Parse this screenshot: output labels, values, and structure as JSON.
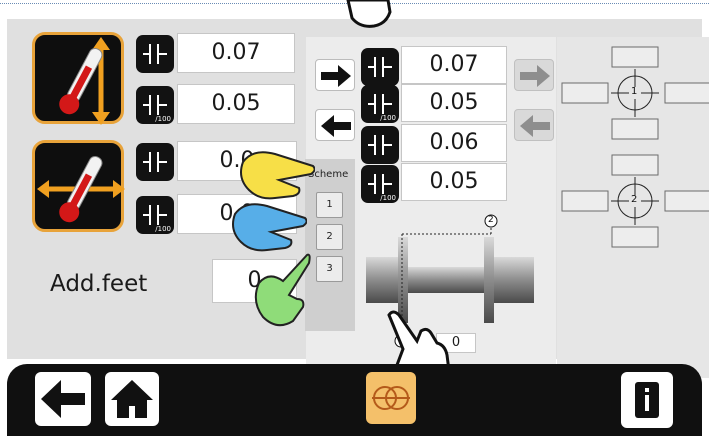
{
  "temperature_compensation": {
    "vertical": {
      "value_1": "0.07",
      "value_2": "0.05",
      "unit_label_2": "/100"
    },
    "horizontal": {
      "value_1": "0.0",
      "value_2": "0.0",
      "unit_label_2": "/100"
    }
  },
  "add_feet": {
    "label": "Add.feet",
    "value": "0"
  },
  "scheme": {
    "title": "Scheme",
    "options": [
      "1",
      "2",
      "3"
    ]
  },
  "target_values": {
    "values": [
      "0.07",
      "0.05",
      "0.06",
      "0.05"
    ],
    "unit_label": "/100"
  },
  "machine_diagram": {
    "marker_1": "1",
    "marker_2": "2",
    "offset_value": "0"
  },
  "sensor_positions": {
    "sensor_1": "1",
    "sensor_2": "2"
  },
  "colors": {
    "accent_orange": "#e8a33a",
    "panel_gray": "#e0e0e0",
    "bar_black": "#101010"
  },
  "icons": [
    "thermometer-vertical-icon",
    "thermometer-horizontal-icon",
    "sensor-icon",
    "arrow-right-icon",
    "arrow-left-icon",
    "back-arrow-icon",
    "home-icon",
    "alignment-view-icon",
    "info-icon",
    "pointing-hand-icon"
  ]
}
